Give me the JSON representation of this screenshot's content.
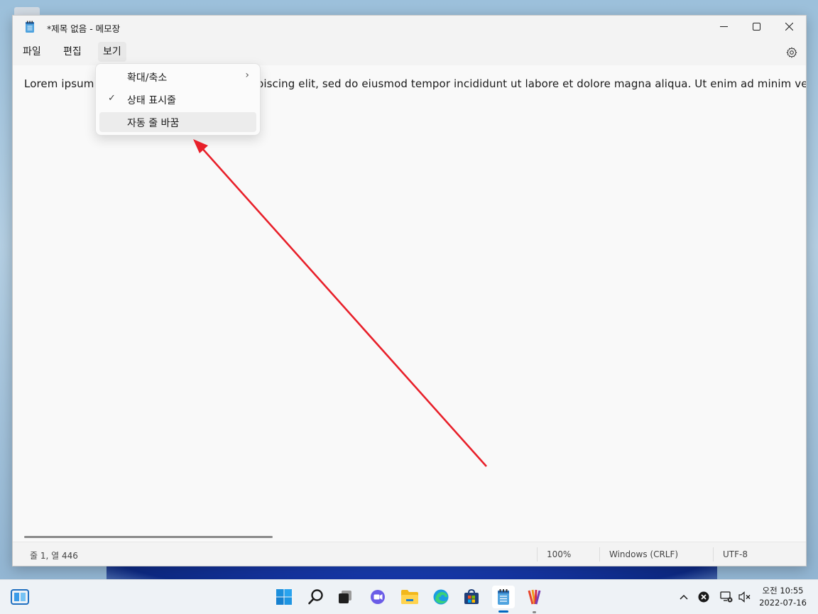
{
  "window": {
    "title": "*제목 없음 - 메모장",
    "controls": {
      "minimize": "minimize",
      "maximize": "maximize",
      "close": "close"
    }
  },
  "menubar": {
    "items": [
      {
        "label": "파일"
      },
      {
        "label": "편집"
      },
      {
        "label": "보기",
        "active": true
      }
    ],
    "settings_icon": "gear-icon"
  },
  "dropdown": {
    "items": [
      {
        "label": "확대/축소",
        "submenu": true
      },
      {
        "label": "상태 표시줄",
        "checked": true
      },
      {
        "label": "자동 줄 바꿈",
        "highlighted": true
      }
    ]
  },
  "editor": {
    "content_left": "Lorem ipsum",
    "content_right": "ipiscing elit, sed do eiusmod tempor incididunt ut labore et dolore magna aliqua. Ut enim ad minim ve"
  },
  "statusbar": {
    "position": "줄 1, 열 446",
    "zoom": "100%",
    "line_ending": "Windows (CRLF)",
    "encoding": "UTF-8"
  },
  "annotation": {
    "arrow_color": "#e8202a"
  },
  "taskbar": {
    "icons": [
      "widgets-icon",
      "start-icon",
      "search-icon",
      "task-view-icon",
      "teams-chat-icon",
      "file-explorer-icon",
      "edge-icon",
      "store-icon",
      "notepad-icon",
      "paint-app-icon"
    ],
    "clock": {
      "time": "오전 10:55",
      "date": "2022-07-16"
    }
  },
  "colors": {
    "accent": "#0067c0",
    "window_bg": "#f9f9f9",
    "chrome_bg": "#f3f3f3"
  }
}
